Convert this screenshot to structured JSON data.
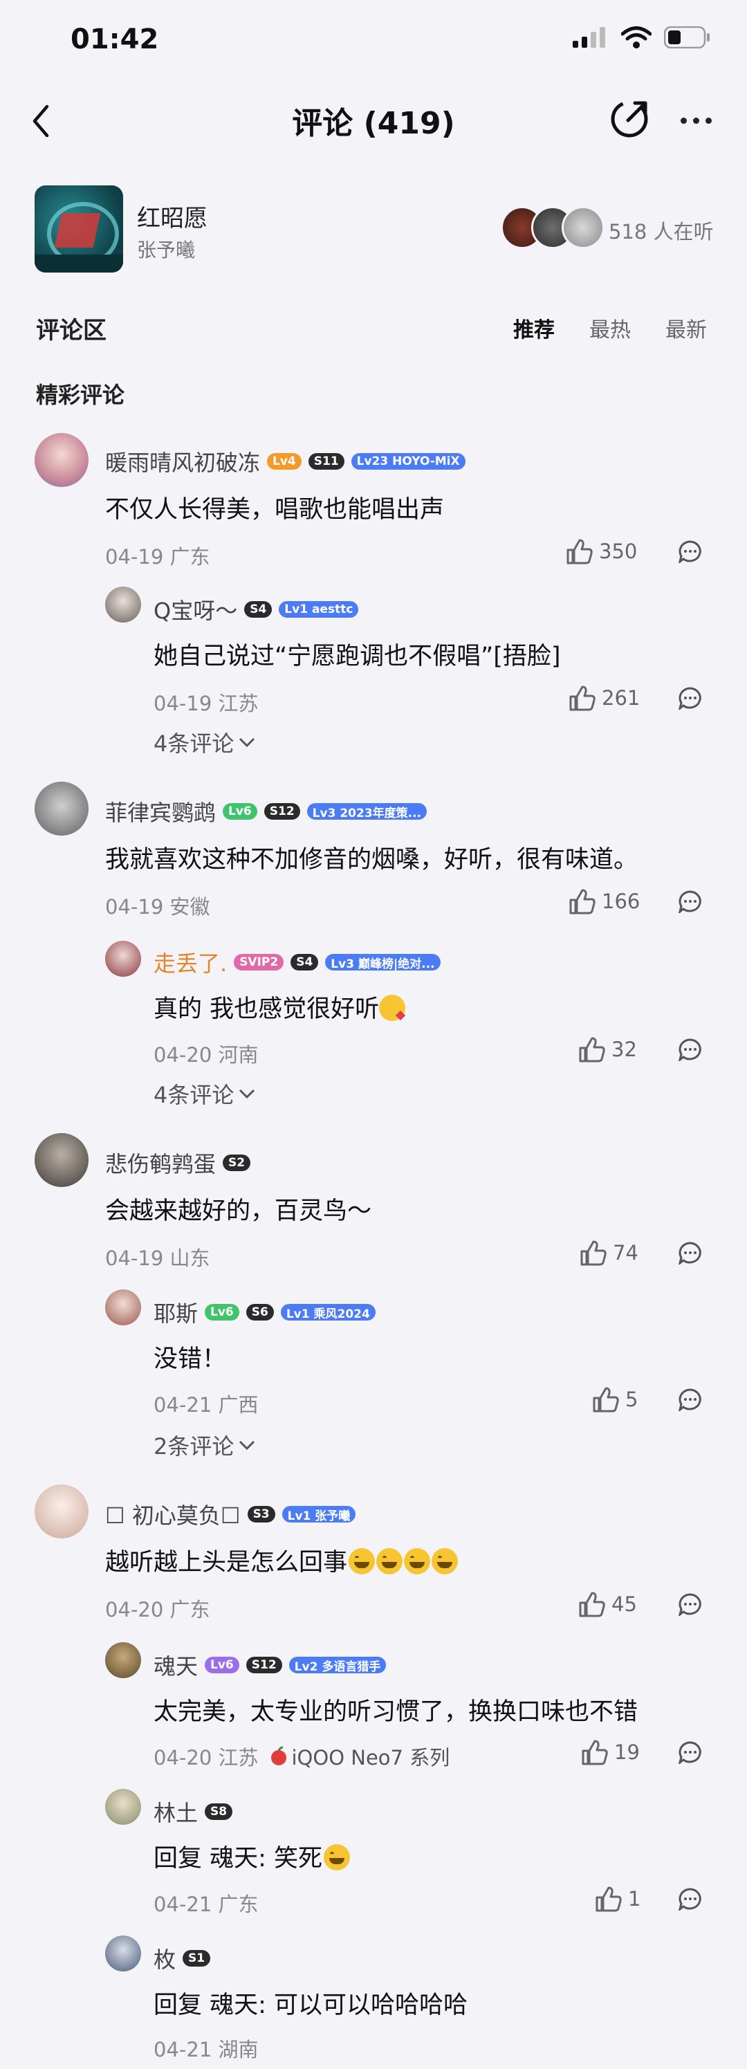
{
  "status_bar": {
    "time": "01:42"
  },
  "header": {
    "title": "评论 (419)"
  },
  "song": {
    "title": "红昭愿",
    "artist": "张予曦",
    "listeners": "518 人在听"
  },
  "section": {
    "label": "评论区",
    "sort_tabs": [
      "推荐",
      "最热",
      "最新"
    ],
    "active_sort": "推荐"
  },
  "featured_label": "精彩评论",
  "colors": {
    "background": "#f3f3f8",
    "accent_blue": "#4c7cf5",
    "text_dark": "#111111",
    "text_gray": "#888888"
  },
  "comments": [
    {
      "user": "暖雨晴风初破冻",
      "badges": [
        "Lv4",
        "S11",
        "Lv23 HOYO-MiX"
      ],
      "text": "不仅人长得美，唱歌也能唱出声",
      "date_loc": "04-19 广东",
      "likes": "350",
      "reply": {
        "user": "Q宝呀～",
        "badges": [
          "S4",
          "Lv1 aesttc"
        ],
        "text": "她自己说过“宁愿跑调也不假唱”[捂脸]",
        "date_loc": "04-19 江苏",
        "likes": "261"
      },
      "more_replies": "4条评论"
    },
    {
      "user": "菲律宾鹦鹉",
      "badges": [
        "Lv6",
        "S12",
        "Lv3 2023年度策..."
      ],
      "text": "我就喜欢这种不加修音的烟嗓，好听，很有味道。",
      "date_loc": "04-19 安徽",
      "likes": "166",
      "reply": {
        "user": "走丢了.",
        "badges": [
          "SVIP2",
          "S4",
          "Lv3 巅峰榜|绝对..."
        ],
        "text": "真的 我也感觉很好听",
        "date_loc": "04-20 河南",
        "likes": "32"
      },
      "more_replies": "4条评论"
    },
    {
      "user": "悲伤鹌鹑蛋",
      "badges": [
        "S2"
      ],
      "text": "会越来越好的，百灵鸟～",
      "date_loc": "04-19 山东",
      "likes": "74",
      "reply": {
        "user": "耶斯",
        "badges": [
          "Lv6",
          "S6",
          "Lv1 乘风2024"
        ],
        "text": "没错！",
        "date_loc": "04-21 广西",
        "likes": "5"
      },
      "more_replies": "2条评论"
    },
    {
      "user": "☐ 初心莫负☐",
      "badges": [
        "S3",
        "Lv1 张予曦"
      ],
      "text": "越听越上头是怎么回事",
      "date_loc": "04-20 广东",
      "likes": "45",
      "replies": [
        {
          "user": "魂天",
          "badges": [
            "Lv6",
            "S12",
            "Lv2 多语言猎手"
          ],
          "text": "太完美，太专业的听习惯了，换换口味也不错",
          "date_loc": "04-20 江苏",
          "device": "iQOO Neo7 系列",
          "likes": "19"
        },
        {
          "user": "林土",
          "badges": [
            "S8"
          ],
          "text": "回复 魂天: 笑死",
          "date_loc": "04-21 广东",
          "likes": "1"
        },
        {
          "user": "枚",
          "badges": [
            "S1"
          ],
          "text": "回复 魂天: 可以可以哈哈哈哈",
          "date_loc": "04-21 湖南"
        }
      ]
    }
  ]
}
